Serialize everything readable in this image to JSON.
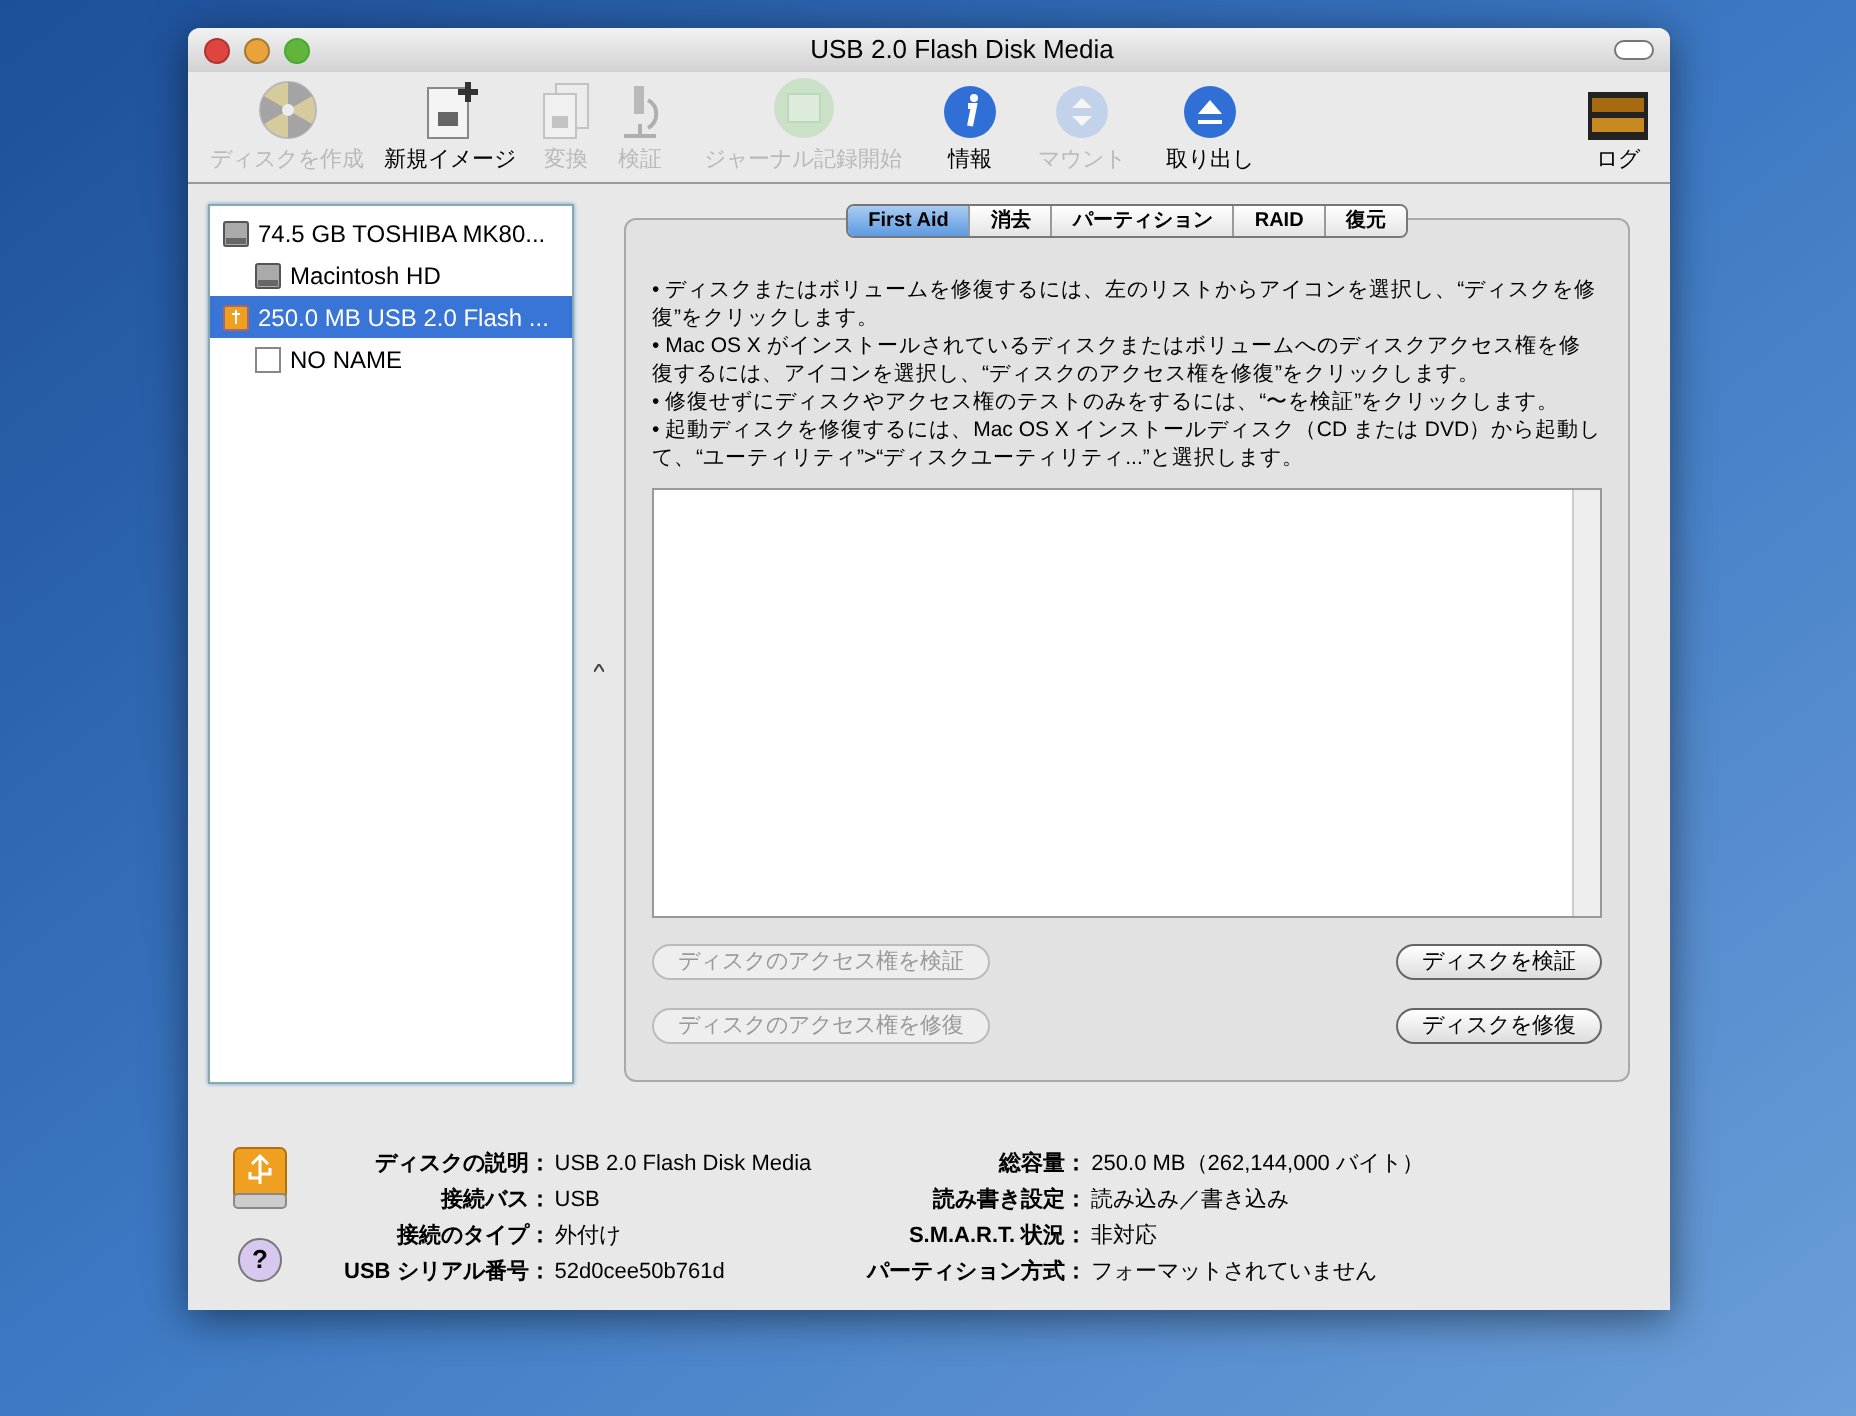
{
  "window": {
    "title": "USB 2.0 Flash Disk Media"
  },
  "toolbar": [
    {
      "kind": "burn",
      "label": "ディスクを作成",
      "disabled": true
    },
    {
      "kind": "new-image",
      "label": "新規イメージ",
      "disabled": false
    },
    {
      "kind": "convert",
      "label": "変換",
      "disabled": true
    },
    {
      "kind": "verify",
      "label": "検証",
      "disabled": true
    },
    {
      "kind": "journal",
      "label": "ジャーナル記録開始",
      "disabled": true
    },
    {
      "kind": "info",
      "label": "情報",
      "disabled": false
    },
    {
      "kind": "mount",
      "label": "マウント",
      "disabled": true
    },
    {
      "kind": "eject",
      "label": "取り出し",
      "disabled": false
    },
    {
      "kind": "log",
      "label": "ログ",
      "disabled": false
    }
  ],
  "sidebar": {
    "items": [
      {
        "kind": "hd",
        "label": "74.5 GB TOSHIBA MK80...",
        "selected": false,
        "children": [
          {
            "kind": "hd",
            "label": "Macintosh HD",
            "selected": false
          }
        ]
      },
      {
        "kind": "usb",
        "label": "250.0 MB USB 2.0 Flash ...",
        "selected": true,
        "children": [
          {
            "kind": "volume",
            "label": "NO NAME",
            "selected": false
          }
        ]
      }
    ]
  },
  "tabs": [
    {
      "label": "First Aid",
      "selected": true
    },
    {
      "label": "消去",
      "selected": false
    },
    {
      "label": "パーティション",
      "selected": false
    },
    {
      "label": "RAID",
      "selected": false
    },
    {
      "label": "復元",
      "selected": false
    }
  ],
  "instructions": [
    "• ディスクまたはボリュームを修復するには、左のリストからアイコンを選択し、“ディスクを修復”をクリックします。",
    "• Mac OS X がインストールされているディスクまたはボリュームへのディスクアクセス権を修復するには、アイコンを選択し、“ディスクのアクセス権を修復”をクリックします。",
    "• 修復せずにディスクやアクセス権のテストのみをするには、“〜を検証”をクリックします。",
    "• 起動ディスクを修復するには、Mac OS X インストールディスク（CD または DVD）から起動して、“ユーティリティ”>“ディスクユーティリティ...”と選択します。"
  ],
  "buttons": [
    [
      {
        "label": "ディスクのアクセス権を検証",
        "disabled": true
      },
      {
        "label": "ディスクを検証",
        "disabled": false
      }
    ],
    [
      {
        "label": "ディスクのアクセス権を修復",
        "disabled": true
      },
      {
        "label": "ディスクを修復",
        "disabled": false
      }
    ]
  ],
  "info": {
    "left": [
      {
        "label": "ディスクの説明：",
        "value": "USB 2.0 Flash Disk Media"
      },
      {
        "label": "接続バス：",
        "value": "USB"
      },
      {
        "label": "接続のタイプ：",
        "value": "外付け"
      },
      {
        "label": "USB シリアル番号：",
        "value": "52d0cee50b761d"
      }
    ],
    "right": [
      {
        "label": "総容量：",
        "value": "250.0 MB（262,144,000 バイト）"
      },
      {
        "label": "読み書き設定：",
        "value": "読み込み／書き込み"
      },
      {
        "label": "S.M.A.R.T. 状況：",
        "value": "非対応"
      },
      {
        "label": "パーティション方式：",
        "value": "フォーマットされていません"
      }
    ]
  },
  "help": {
    "label": "?"
  }
}
